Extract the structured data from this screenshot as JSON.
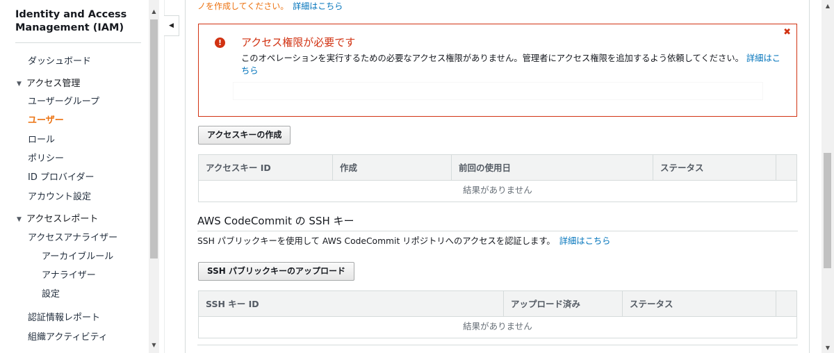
{
  "sidebar": {
    "title": "Identity and Access Management (IAM)",
    "dashboard": "ダッシュボード",
    "access_management": {
      "label": "アクセス管理",
      "items": [
        "ユーザーグループ",
        "ユーザー",
        "ロール",
        "ポリシー",
        "ID プロバイダー",
        "アカウント設定"
      ],
      "active": "ユーザー"
    },
    "access_reports": {
      "label": "アクセスレポート",
      "analyzer": "アクセスアナライザー",
      "sub_items": [
        "アーカイブルール",
        "アナライザー",
        "設定"
      ],
      "items": [
        "認証情報レポート",
        "組織アクティビティ"
      ]
    }
  },
  "top_cut": {
    "text": "ノを作成してください。",
    "link": "詳細はこちら"
  },
  "alert": {
    "title": "アクセス権限が必要です",
    "body": "このオペレーションを実行するための必要なアクセス権限がありません。管理者にアクセス権限を追加するよう依頼してください。",
    "link": "詳細はこちら",
    "close_glyph": "✖",
    "icon_glyph": "!"
  },
  "access_keys": {
    "create_button": "アクセスキーの作成",
    "columns": [
      "アクセスキー ID",
      "作成",
      "前回の使用日",
      "ステータス"
    ],
    "empty": "結果がありません"
  },
  "ssh": {
    "heading": "AWS CodeCommit の SSH キー",
    "description": "SSH パブリックキーを使用して AWS CodeCommit リポジトリへのアクセスを認証します。",
    "link": "詳細はこちら",
    "upload_button": "SSH パブリックキーのアップロード",
    "columns": [
      "SSH キー ID",
      "アップロード済み",
      "ステータス"
    ],
    "empty": "結果がありません"
  },
  "colors": {
    "error": "#d13212",
    "link": "#0073bb",
    "active_nav": "#ec7211"
  }
}
